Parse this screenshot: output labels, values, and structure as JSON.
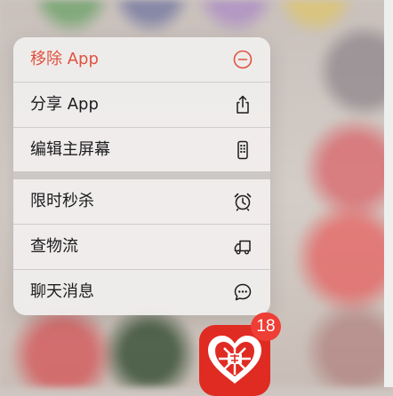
{
  "menu": {
    "items": [
      {
        "label": "移除 App",
        "icon": "minus-circle-icon",
        "destructive": true
      },
      {
        "label": "分享 App",
        "icon": "share-icon",
        "destructive": false
      },
      {
        "label": "编辑主屏幕",
        "icon": "phone-edit-icon",
        "destructive": false
      },
      {
        "label": "限时秒杀",
        "icon": "alarm-clock-icon",
        "destructive": false
      },
      {
        "label": "查物流",
        "icon": "delivery-truck-icon",
        "destructive": false
      },
      {
        "label": "聊天消息",
        "icon": "chat-bubble-icon",
        "destructive": false
      }
    ]
  },
  "app": {
    "icon": "pinduoduo-app-icon",
    "badge": "18"
  },
  "colors": {
    "destructive": "#e0513f",
    "badge": "#ee3e35",
    "app_red": "#e02b22"
  }
}
